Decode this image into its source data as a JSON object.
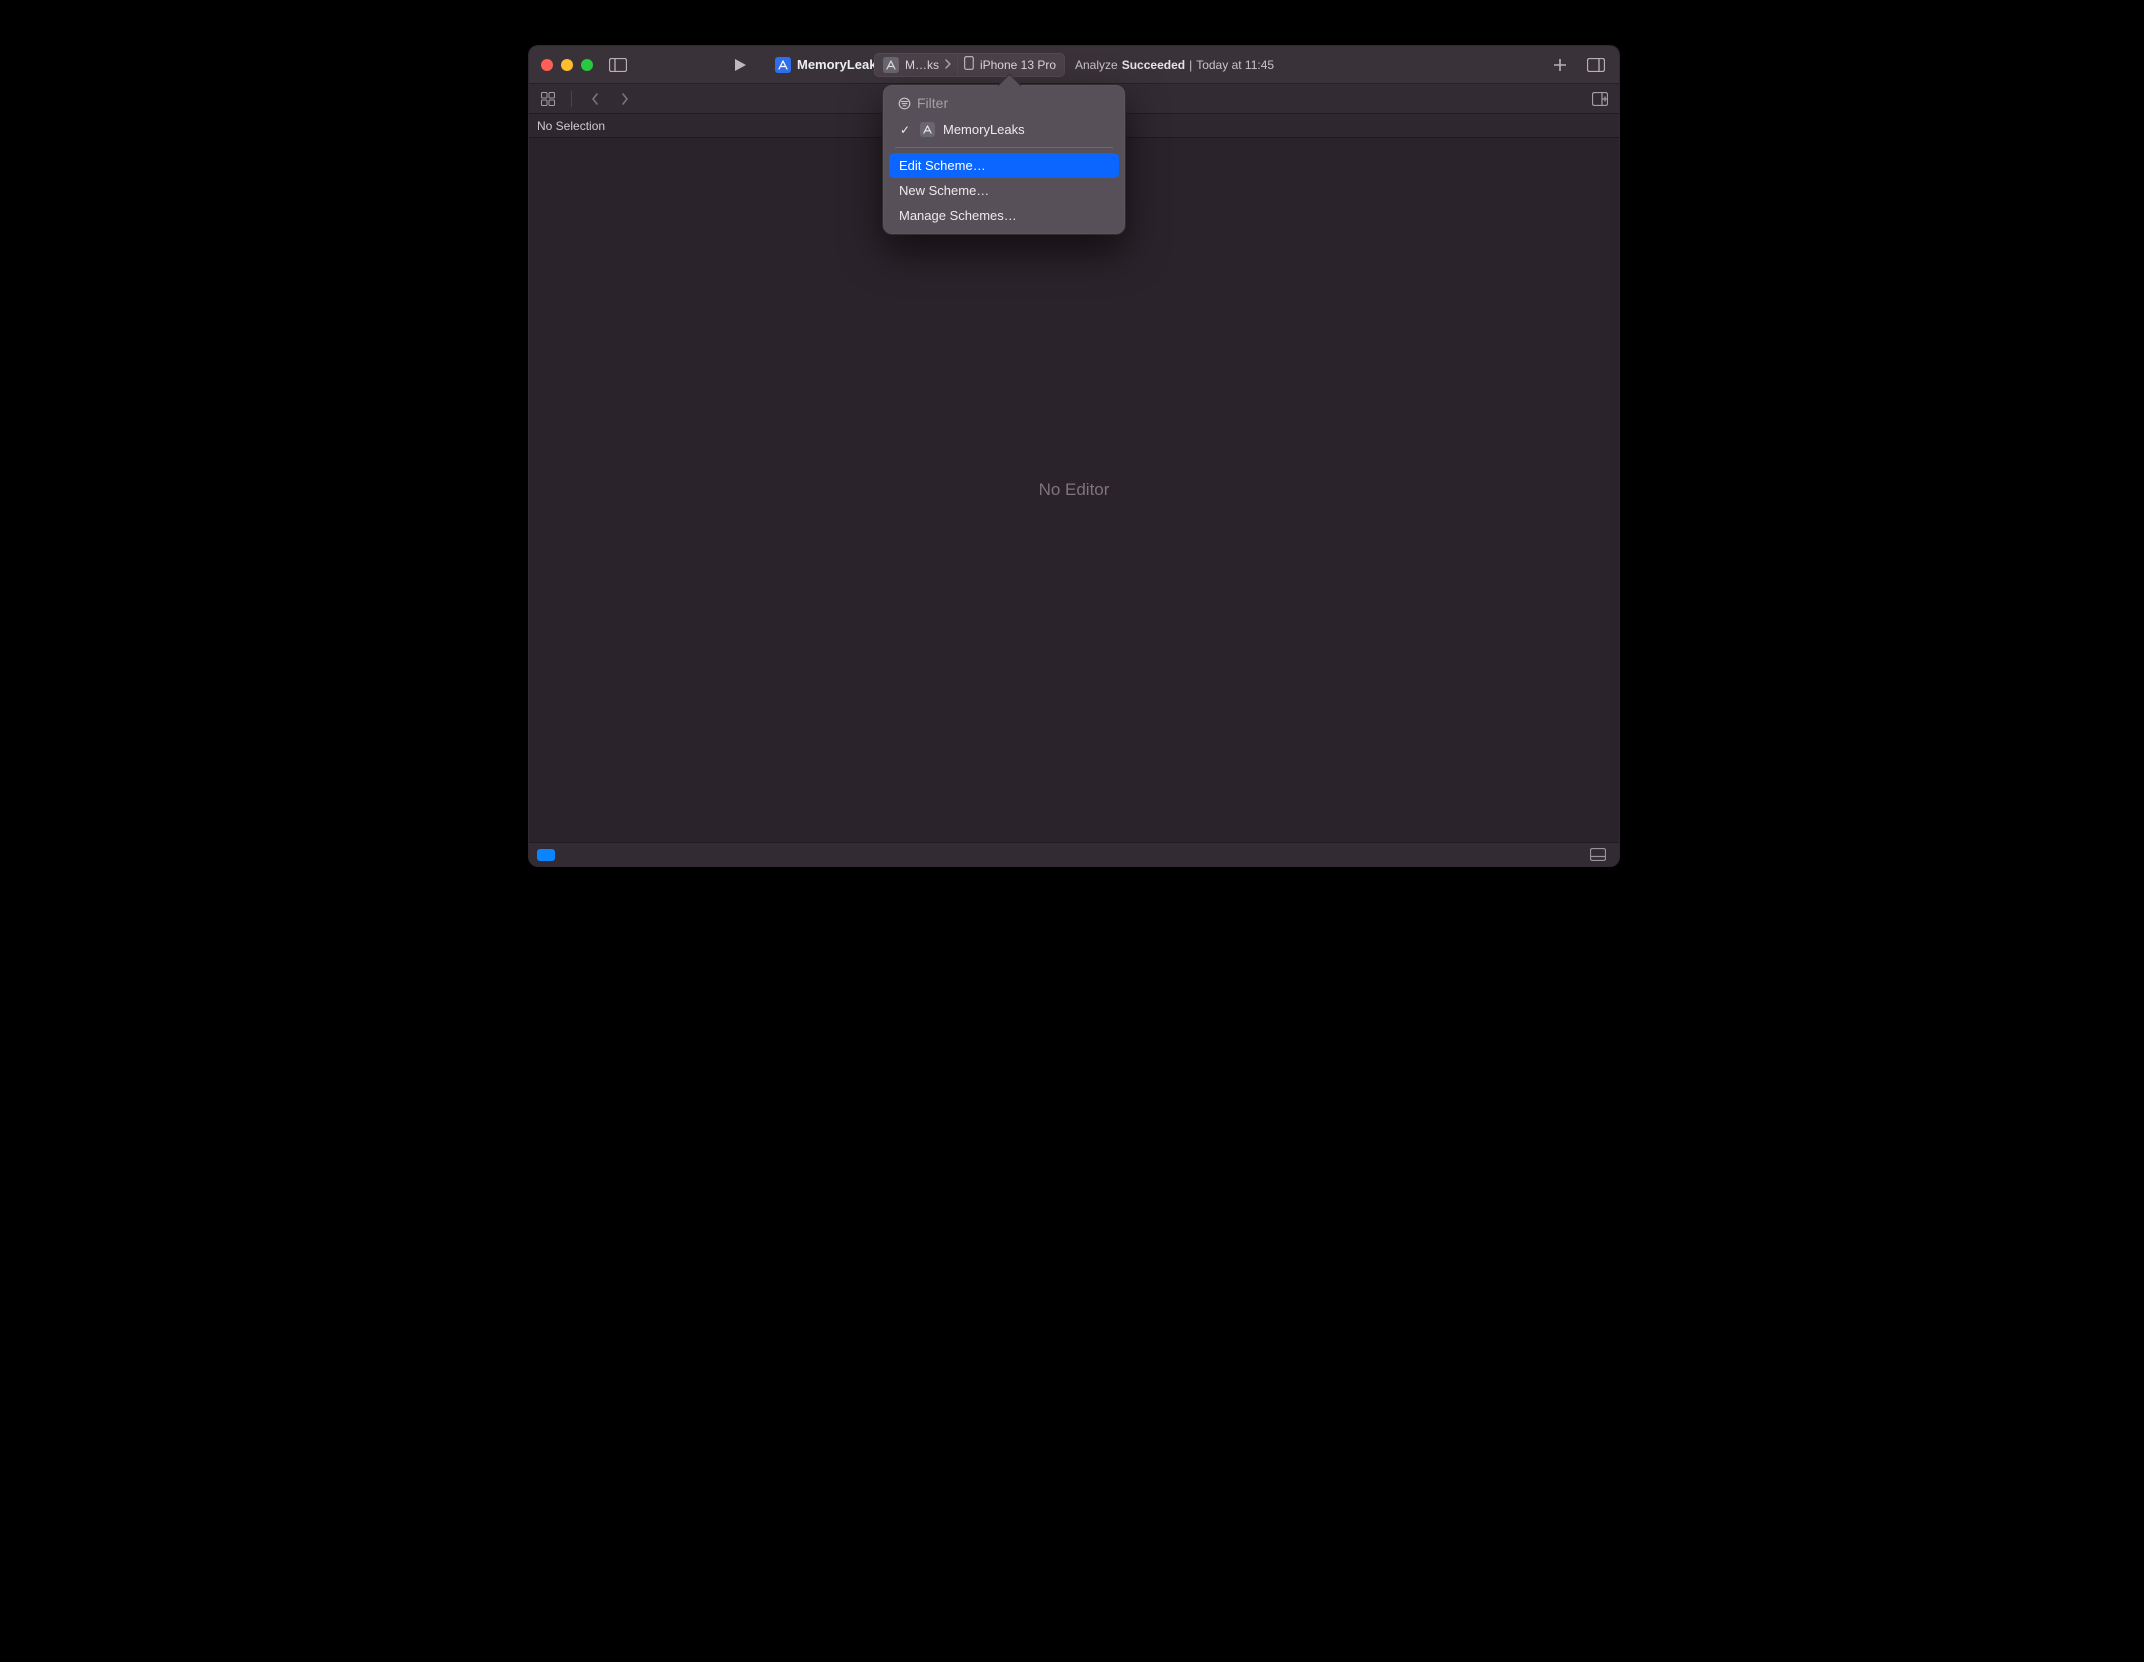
{
  "toolbar": {
    "project_name": "MemoryLeaks",
    "scheme_truncated": "M…ks",
    "device": "iPhone 13 Pro"
  },
  "status": {
    "action": "Analyze",
    "result": "Succeeded",
    "separator": "|",
    "timestamp": "Today at 11:45"
  },
  "breadcrumb": {
    "text": "No Selection"
  },
  "editor": {
    "placeholder": "No Editor"
  },
  "popover": {
    "filter_placeholder": "Filter",
    "current_scheme": "MemoryLeaks",
    "menu": {
      "edit": "Edit Scheme…",
      "newScheme": "New Scheme…",
      "manage": "Manage Schemes…"
    }
  }
}
